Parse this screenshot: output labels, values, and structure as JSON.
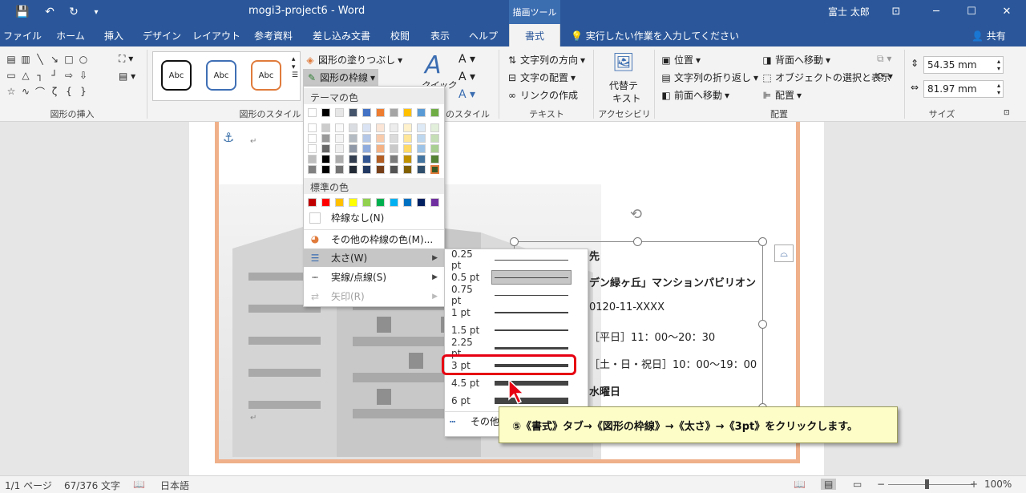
{
  "titlebar": {
    "doc_title": "mogi3-project6  -  Word",
    "context_tool": "描画ツール",
    "user": "富士 太郎",
    "qa_save": "💾",
    "qa_undo": "↶",
    "qa_redo": "↻",
    "qa_more": "▾",
    "min": "─",
    "max": "☐",
    "close": "✕",
    "ribbon_display": "⊡"
  },
  "tabs": [
    "ファイル",
    "ホーム",
    "挿入",
    "デザイン",
    "レイアウト",
    "参考資料",
    "差し込み文書",
    "校閲",
    "表示",
    "ヘルプ",
    "書式"
  ],
  "tell_me": "実行したい作業を入力してください",
  "share": "共有",
  "ribbon": {
    "groups": {
      "insert_shapes": "図形の挿入",
      "shape_styles": "図形のスタイル",
      "wordart_styles": "ワードアートのスタイル",
      "text": "テキスト",
      "accessibility": "アクセシビリティ",
      "arrange": "配置",
      "size": "サイズ"
    },
    "style_abc": [
      "Abc",
      "Abc",
      "Abc"
    ],
    "fill": "図形の塗りつぶし",
    "outline": "図形の枠線",
    "quick_style": "クイック",
    "text_direction": "文字列の方向",
    "text_align": "文字の配置",
    "create_link": "リンクの作成",
    "alt_text_1": "代替テ",
    "alt_text_2": "キスト",
    "position": "位置",
    "wrap_text": "文字列の折り返し",
    "bring_forward": "前面へ移動",
    "send_backward": "背面へ移動",
    "selection_pane": "オブジェクトの選択と表示",
    "align": "配置",
    "height": "54.35 mm",
    "width": "81.97 mm"
  },
  "menu": {
    "theme_colors": "テーマの色",
    "standard_colors": "標準の色",
    "no_outline": "枠線なし(N)",
    "more_colors": "その他の枠線の色(M)...",
    "weight": "太さ(W)",
    "dashes": "実線/点線(S)",
    "arrows": "矢印(R)",
    "theme_top": [
      "#ffffff",
      "#000000",
      "#e7e6e6",
      "#44546a",
      "#4472c4",
      "#ed7d31",
      "#a5a5a5",
      "#ffc000",
      "#5b9bd5",
      "#70ad47"
    ],
    "standard": [
      "#c00000",
      "#ff0000",
      "#ffc000",
      "#ffff00",
      "#92d050",
      "#00b050",
      "#00b0f0",
      "#0070c0",
      "#002060",
      "#7030a0"
    ]
  },
  "weights": [
    "0.25 pt",
    "0.5 pt",
    "0.75 pt",
    "1 pt",
    "1.5 pt",
    "2.25 pt",
    "3 pt",
    "4.5 pt",
    "6 pt"
  ],
  "weight_more": "その他",
  "doc": {
    "line1": "先",
    "line2": "デン緑ヶ丘」マンションパビリオン",
    "line3": "0120-11-XXXX",
    "line4": "［平日］11：00〜20：30",
    "line5": "［土・日・祝日］10：00〜19：00",
    "line6": "水曜日"
  },
  "callout": "⑤《書式》タブ→《図形の枠線》→《太さ》→《3pt》をクリックします。",
  "status": {
    "page": "1/1 ページ",
    "words": "67/376 文字",
    "lang": "日本語",
    "zoom": "100%"
  }
}
